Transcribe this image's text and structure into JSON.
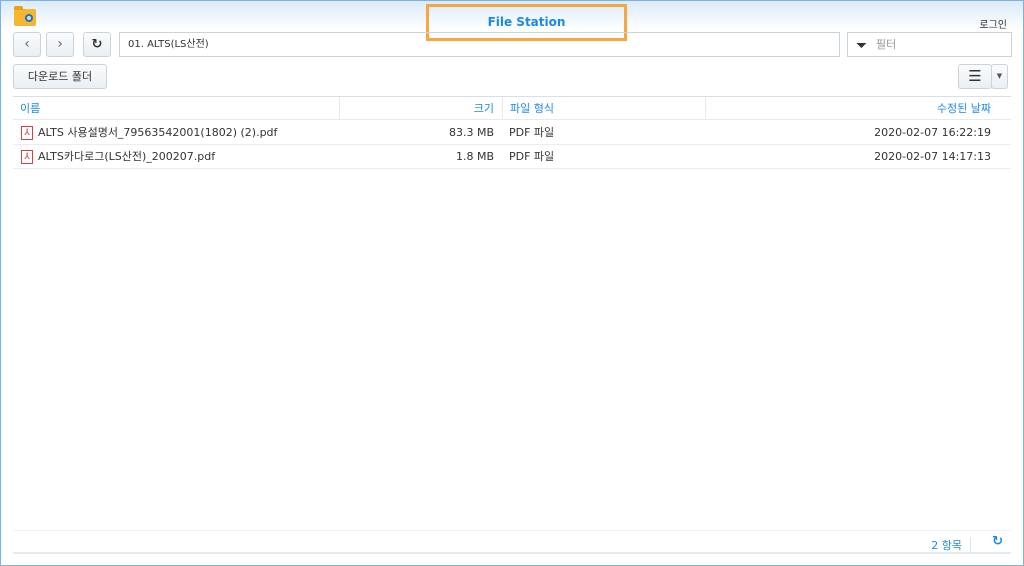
{
  "app": {
    "title": "File Station",
    "login": "로그인"
  },
  "toolbar": {
    "path": "01. ALTS(LS산전)",
    "filter_placeholder": "필터",
    "download_folder": "다운로드 폴더"
  },
  "columns": {
    "name": "이름",
    "size": "크기",
    "type": "파일 형식",
    "modified": "수정된 날짜"
  },
  "files": [
    {
      "name": "ALTS 사용설명서_79563542001(1802) (2).pdf",
      "size": "83.3 MB",
      "type": "PDF 파일",
      "modified": "2020-02-07 16:22:19"
    },
    {
      "name": "ALTS카다로그(LS산전)_200207.pdf",
      "size": "1.8 MB",
      "type": "PDF 파일",
      "modified": "2020-02-07 14:17:13"
    }
  ],
  "footer": {
    "count": "2 항목"
  }
}
